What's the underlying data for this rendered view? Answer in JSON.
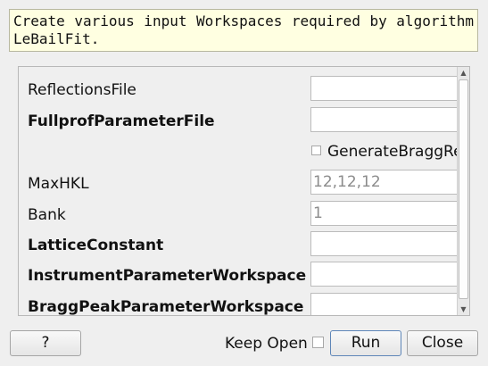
{
  "description": {
    "line1": "Create various input Workspaces required by algorithm",
    "line2": "LeBailFit."
  },
  "properties": [
    {
      "name": "ReflectionsFile",
      "bold": false,
      "kind": "text",
      "value": ""
    },
    {
      "name": "FullprofParameterFile",
      "bold": true,
      "kind": "text",
      "value": ""
    },
    {
      "name": "GenerateBraggRe",
      "bold": false,
      "kind": "checkbox",
      "checked": false
    },
    {
      "name": "MaxHKL",
      "bold": false,
      "kind": "text",
      "value": "12,12,12"
    },
    {
      "name": "Bank",
      "bold": false,
      "kind": "text",
      "value": "1"
    },
    {
      "name": "LatticeConstant",
      "bold": true,
      "kind": "text",
      "value": ""
    },
    {
      "name": "InstrumentParameterWorkspace",
      "bold": true,
      "kind": "text",
      "value": ""
    },
    {
      "name": "BraggPeakParameterWorkspace",
      "bold": true,
      "kind": "text",
      "value": ""
    }
  ],
  "buttons": {
    "help": "?",
    "keep_open": "Keep Open",
    "keep_open_checked": false,
    "run": "Run",
    "close": "Close"
  },
  "icons": {
    "scroll_up": "scroll-up-arrow-icon",
    "scroll_down": "scroll-down-arrow-icon"
  },
  "colors": {
    "description_bg": "#ffffe1",
    "window_bg": "#efefef",
    "run_border": "#5e86b8"
  }
}
